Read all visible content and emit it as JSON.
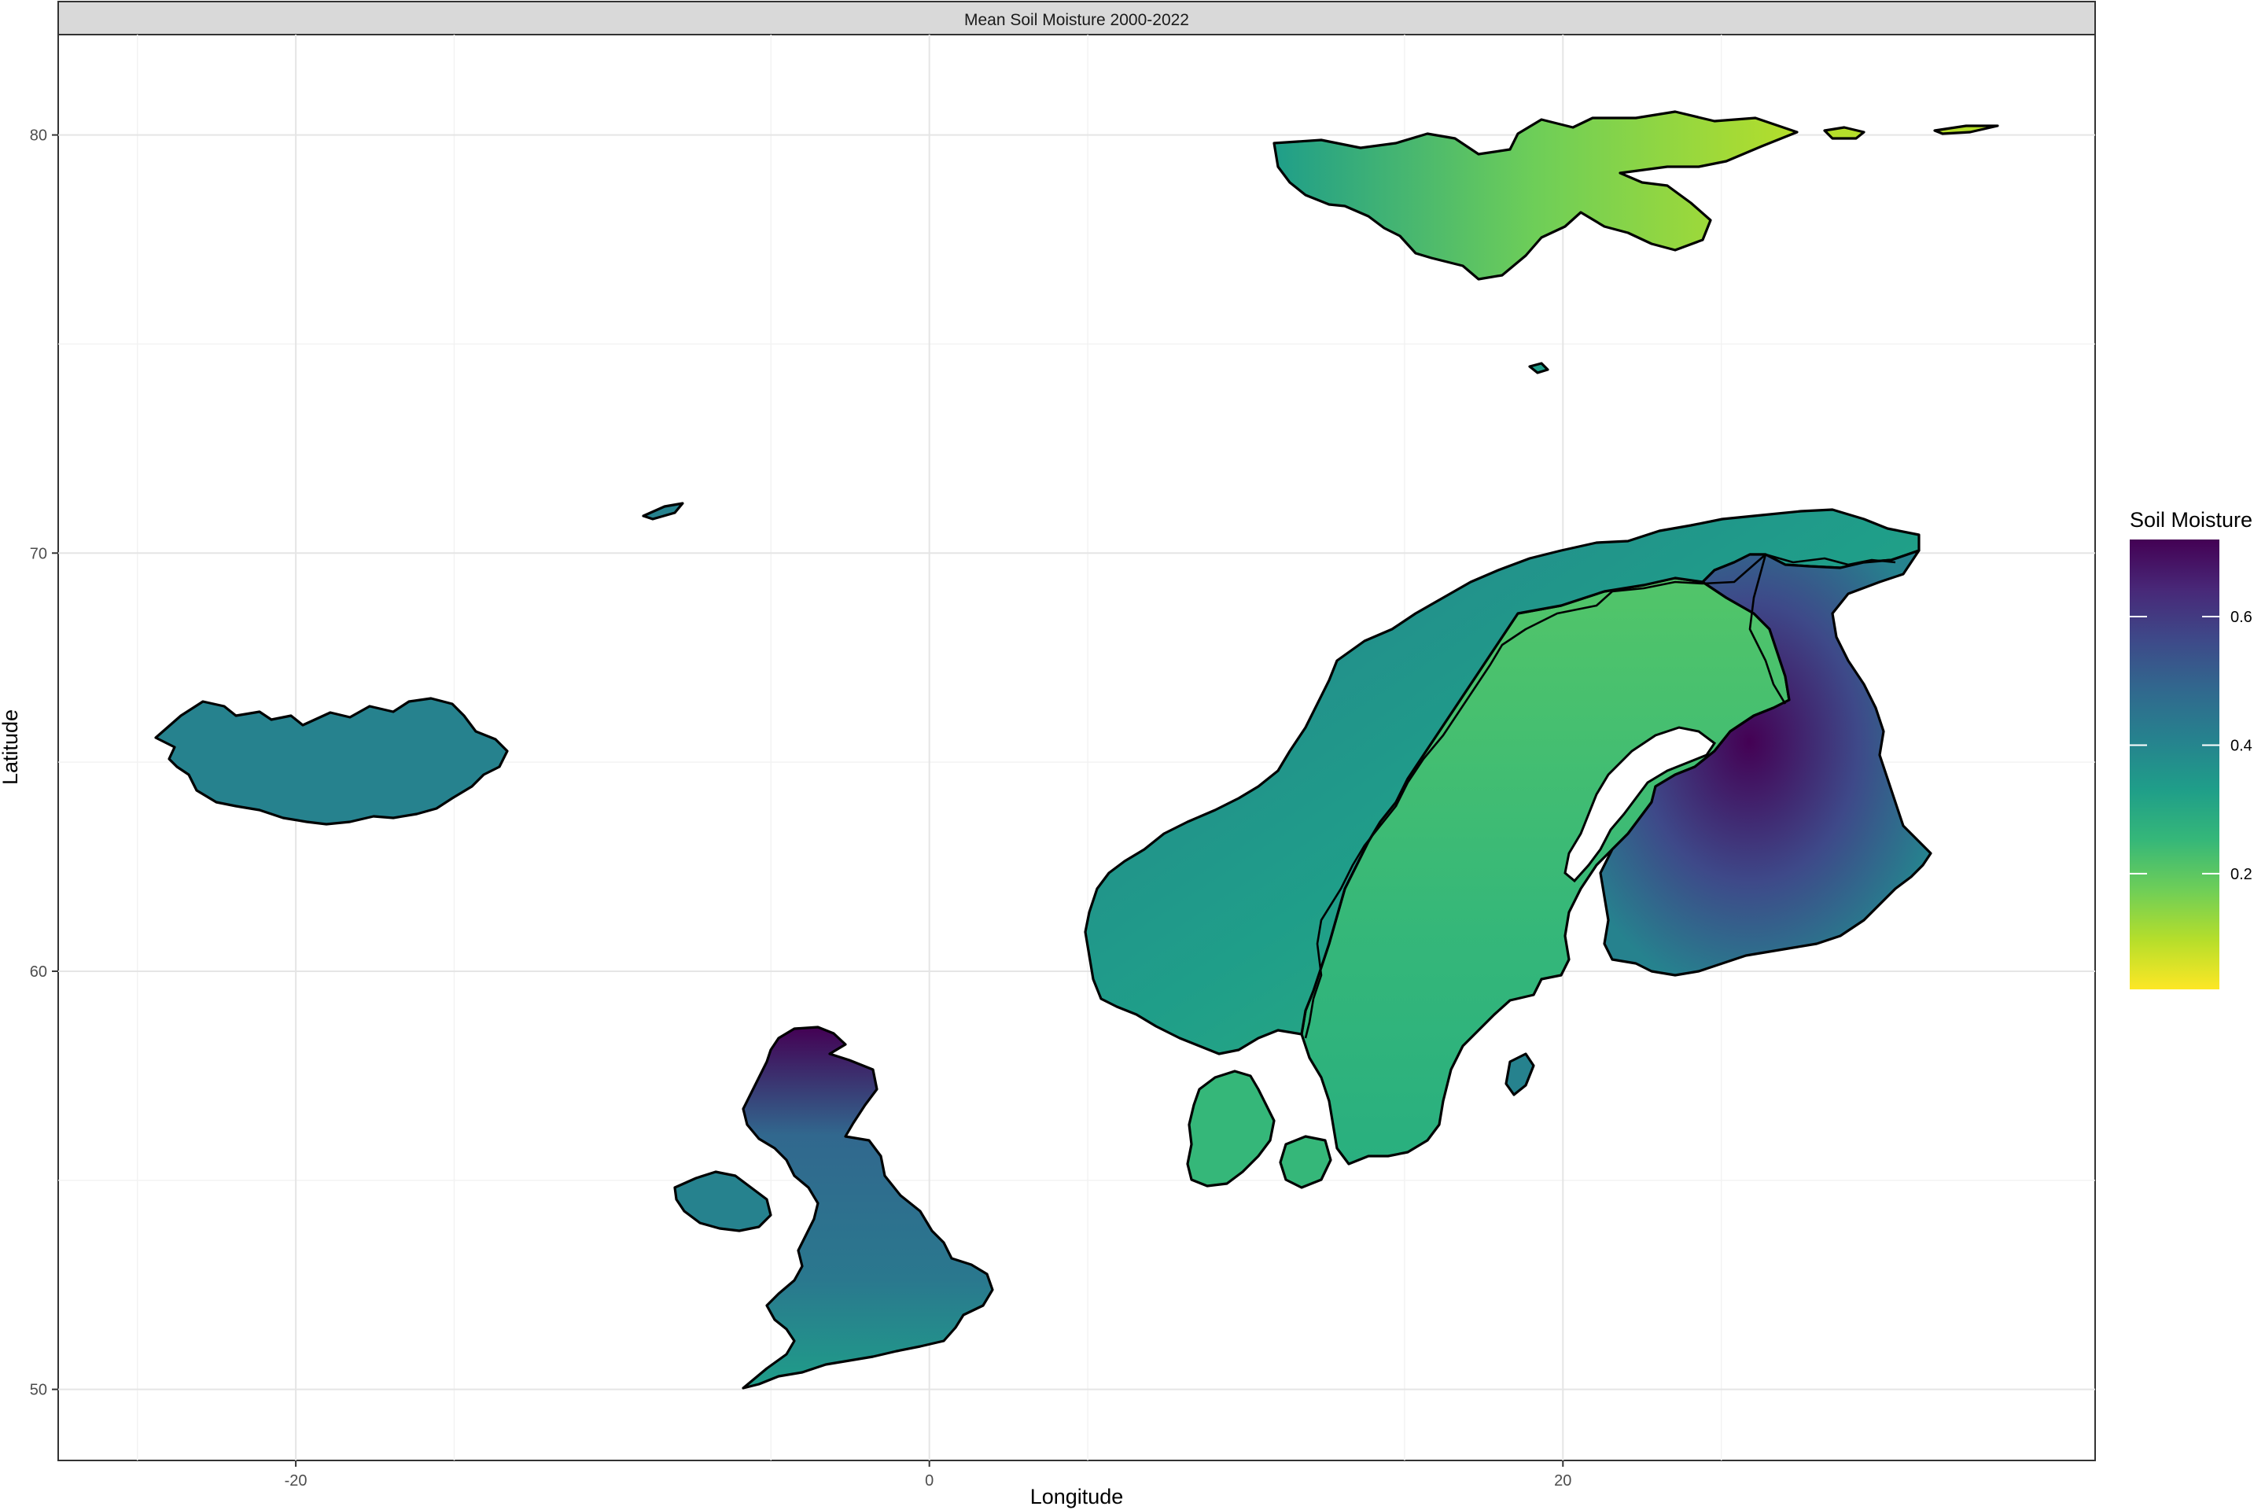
{
  "panel": {
    "strip_title": "Mean Soil Moisture 2000-2022",
    "xlabel": "Longitude",
    "ylabel": "Latitude"
  },
  "axes": {
    "x_ticks": [
      {
        "value": -20,
        "label": "-20"
      },
      {
        "value": 0,
        "label": "0"
      },
      {
        "value": 20,
        "label": "20"
      }
    ],
    "y_ticks": [
      {
        "value": 50,
        "label": "50"
      },
      {
        "value": 60,
        "label": "60"
      },
      {
        "value": 70,
        "label": "70"
      },
      {
        "value": 80,
        "label": "80"
      }
    ],
    "xlim": [
      -27.5,
      36.8
    ],
    "ylim": [
      48.3,
      82.4
    ]
  },
  "legend": {
    "title": "Soil Moisture",
    "colormap": "viridis (reversed)",
    "range": [
      0.02,
      0.72
    ],
    "ticks": [
      {
        "value": 0.6,
        "label": "0.6"
      },
      {
        "value": 0.4,
        "label": "0.4"
      },
      {
        "value": 0.2,
        "label": "0.2"
      }
    ],
    "colors": [
      "#fde725",
      "#b5de2b",
      "#6ece58",
      "#35b779",
      "#1f9e89",
      "#26828e",
      "#31688e",
      "#3e4989",
      "#482878",
      "#440154"
    ]
  },
  "regions": [
    {
      "name": "Svalbard",
      "mean_moisture": 0.25
    },
    {
      "name": "Iceland",
      "mean_moisture": 0.33
    },
    {
      "name": "Great Britain",
      "mean_moisture": 0.37
    },
    {
      "name": "Ireland",
      "mean_moisture": 0.33
    },
    {
      "name": "Norway",
      "mean_moisture": 0.3
    },
    {
      "name": "Sweden",
      "mean_moisture": 0.27
    },
    {
      "name": "Finland",
      "mean_moisture": 0.5
    },
    {
      "name": "Denmark",
      "mean_moisture": 0.3
    }
  ]
}
